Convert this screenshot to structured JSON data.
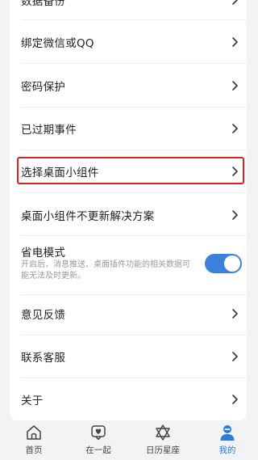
{
  "settings": {
    "cut_top_label": "数据备份",
    "items": [
      {
        "label": "绑定微信或QQ"
      },
      {
        "label": "密码保护"
      },
      {
        "label": "已过期事件"
      },
      {
        "label": "选择桌面小组件"
      },
      {
        "label": "桌面小组件不更新解决方案"
      }
    ],
    "power_saving": {
      "title": "省电模式",
      "description": "开启后，消息推送、桌面插件功能的相关数据可能无法及时更新。",
      "enabled": true
    },
    "items_after": [
      {
        "label": "意见反馈"
      },
      {
        "label": "联系客服"
      },
      {
        "label": "关于"
      }
    ]
  },
  "tabbar": {
    "tabs": [
      {
        "label": "首页",
        "icon": "home-icon"
      },
      {
        "label": "在一起",
        "icon": "heart-message-icon"
      },
      {
        "label": "日历星座",
        "icon": "star-of-david-icon"
      },
      {
        "label": "我的",
        "icon": "profile-icon"
      }
    ],
    "active_index": 3
  },
  "colors": {
    "accent": "#3d7fdd",
    "highlight": "#d7222a",
    "active_tab": "#2f7bdc"
  }
}
